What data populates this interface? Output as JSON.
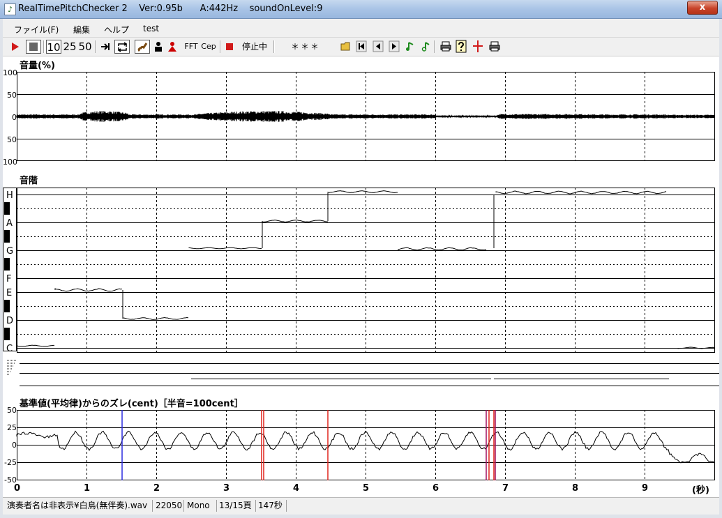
{
  "window": {
    "title": "RealTimePitchChecker 2    Ver:0.95b      A:442Hz    soundOnLevel:9",
    "close_glyph": "x"
  },
  "menu": [
    "ファイル(F)",
    "編集",
    "ヘルプ",
    "test"
  ],
  "toolbar": {
    "speed_10": "10",
    "speed_25": "25",
    "speed_50": "50",
    "fft_label": "FFT",
    "cep_label": "Cep",
    "status_text": "停止中",
    "pitch_readout": "＊＊＊"
  },
  "volume_panel": {
    "title": "音量(%)",
    "y_labels": [
      "100",
      "50",
      "0",
      "50",
      "100"
    ]
  },
  "scale_panel": {
    "title": "音階",
    "notes": [
      "H",
      "A",
      "G",
      "F",
      "E",
      "D",
      "C"
    ]
  },
  "cent_panel": {
    "title": "基準値(平均律)からのズレ(cent)［半音=100cent］",
    "y_labels": [
      "50",
      "25",
      "0",
      "-25",
      "-50"
    ]
  },
  "time_axis": {
    "ticks": [
      "0",
      "1",
      "2",
      "3",
      "4",
      "5",
      "6",
      "7",
      "8",
      "9"
    ],
    "unit": "(秒)"
  },
  "status": {
    "performer": "演奏者名は非表示¥白鳥(無伴奏).wav",
    "sample_rate": "22050",
    "channel": "Mono",
    "page": "13/15頁",
    "length": "147秒"
  },
  "colors": {
    "accent_red": "#d11a1a",
    "marker_red": "#e0241c",
    "marker_blue": "#2a2adf",
    "marker_purple": "#a01060"
  }
}
